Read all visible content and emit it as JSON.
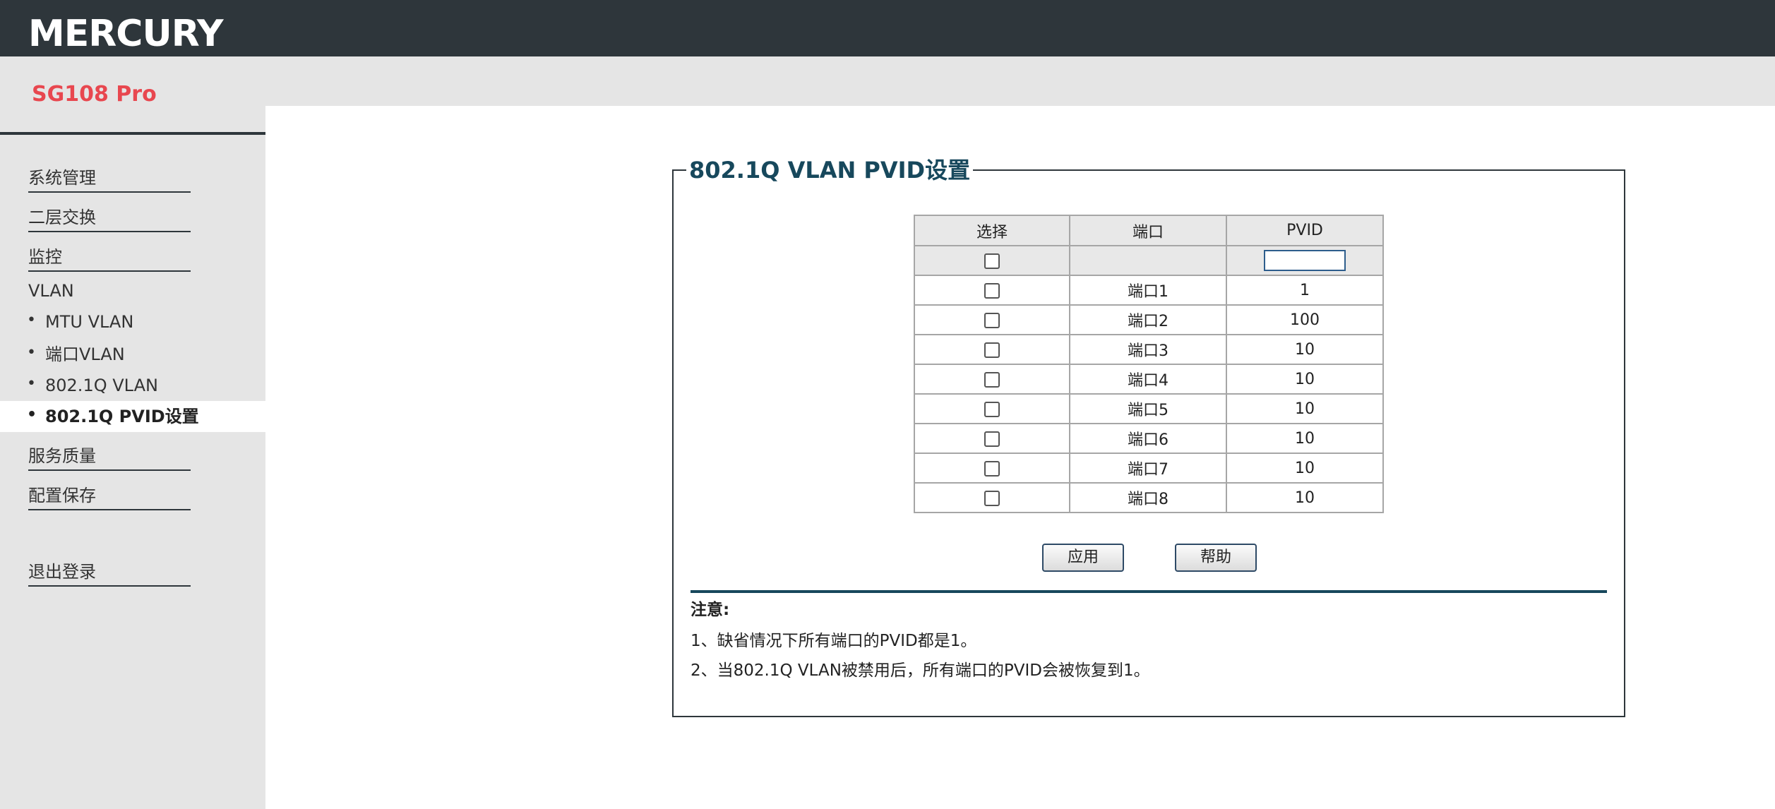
{
  "header": {
    "brand": "MERCURY"
  },
  "sidebar": {
    "model": "SG108 Pro",
    "menu": [
      {
        "label": "系统管理"
      },
      {
        "label": "二层交换"
      },
      {
        "label": "监控"
      },
      {
        "label": "VLAN"
      }
    ],
    "vlan_sub": [
      {
        "label": "MTU VLAN"
      },
      {
        "label": "端口VLAN"
      },
      {
        "label": "802.1Q VLAN"
      },
      {
        "label": "802.1Q PVID设置"
      }
    ],
    "menu_after": [
      {
        "label": "服务质量"
      },
      {
        "label": "配置保存"
      }
    ],
    "logout": "退出登录",
    "bullet": "•"
  },
  "main": {
    "title": "802.1Q VLAN PVID设置",
    "table": {
      "headers": [
        "选择",
        "端口",
        "PVID"
      ],
      "rows": [
        {
          "port": "端口1",
          "pvid": "1"
        },
        {
          "port": "端口2",
          "pvid": "100"
        },
        {
          "port": "端口3",
          "pvid": "10"
        },
        {
          "port": "端口4",
          "pvid": "10"
        },
        {
          "port": "端口5",
          "pvid": "10"
        },
        {
          "port": "端口6",
          "pvid": "10"
        },
        {
          "port": "端口7",
          "pvid": "10"
        },
        {
          "port": "端口8",
          "pvid": "10"
        }
      ],
      "pvid_input_value": ""
    },
    "buttons": {
      "apply": "应用",
      "help": "帮助"
    },
    "notes": {
      "title": "注意:",
      "lines": [
        "1、缺省情况下所有端口的PVID都是1。",
        "2、当802.1Q VLAN被禁用后，所有端口的PVID会被恢复到1。"
      ]
    }
  }
}
